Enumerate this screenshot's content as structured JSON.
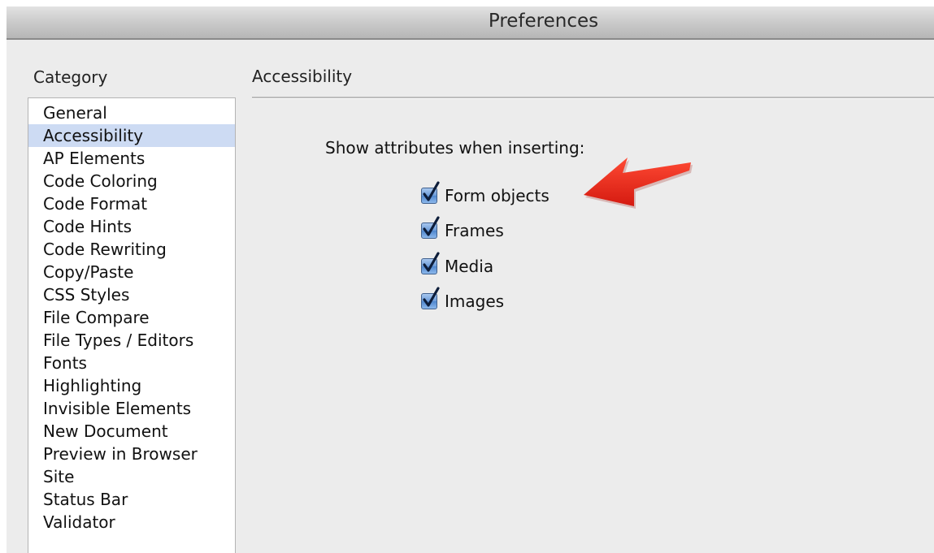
{
  "window": {
    "title": "Preferences"
  },
  "sidebar": {
    "label": "Category",
    "selected_index": 1,
    "items": [
      {
        "label": "General"
      },
      {
        "label": "Accessibility"
      },
      {
        "label": "AP Elements"
      },
      {
        "label": "Code Coloring"
      },
      {
        "label": "Code Format"
      },
      {
        "label": "Code Hints"
      },
      {
        "label": "Code Rewriting"
      },
      {
        "label": "Copy/Paste"
      },
      {
        "label": "CSS Styles"
      },
      {
        "label": "File Compare"
      },
      {
        "label": "File Types / Editors"
      },
      {
        "label": "Fonts"
      },
      {
        "label": "Highlighting"
      },
      {
        "label": "Invisible Elements"
      },
      {
        "label": "New Document"
      },
      {
        "label": "Preview in Browser"
      },
      {
        "label": "Site"
      },
      {
        "label": "Status Bar"
      },
      {
        "label": "Validator"
      }
    ]
  },
  "panel": {
    "heading": "Accessibility",
    "prompt": "Show attributes when inserting:",
    "options": [
      {
        "label": "Form objects",
        "checked": true
      },
      {
        "label": "Frames",
        "checked": true
      },
      {
        "label": "Media",
        "checked": true
      },
      {
        "label": "Images",
        "checked": true
      }
    ]
  },
  "annotation": {
    "arrow_color": "#e8261b",
    "icon": "red-arrow-icon"
  },
  "colors": {
    "selection": "#cddbf3",
    "checkbox_blue": "#4f86cd"
  }
}
